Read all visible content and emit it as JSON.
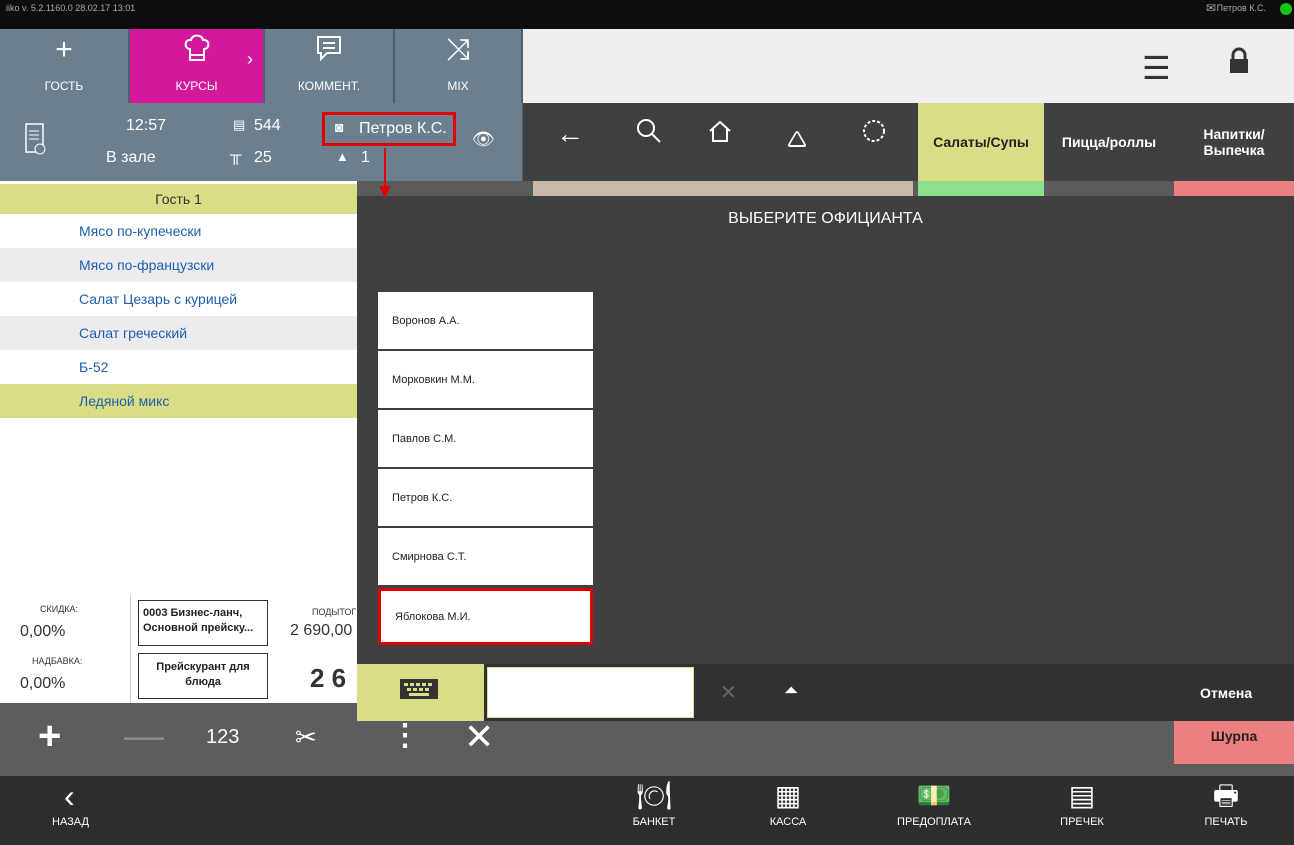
{
  "sysbar": {
    "version": "iiko v. 5.2.1160.0   28.02.17  13:01",
    "user": "Петров К.С."
  },
  "toolbar": {
    "guest_label": "ГОСТЬ",
    "courses_label": "КУРСЫ",
    "comment_label": "КОММЕНТ.",
    "mix_label": "MIX"
  },
  "info": {
    "time": "12:57",
    "location": "В зале",
    "order_number": "544",
    "table_number": "25",
    "waiter": "Петров К.С.",
    "guests_count": "1"
  },
  "categories": [
    "Салаты/Супы",
    "Пицца/роллы",
    "Напитки/ Выпечка"
  ],
  "order": {
    "guest_label": "Гость 1",
    "items": [
      "Мясо по-купечески",
      "Мясо по-французски",
      "Салат Цезарь с курицей",
      "Салат греческий",
      "Б-52",
      "Ледяной микс"
    ]
  },
  "totals": {
    "discount_label": "СКИДКА:",
    "discount_value": "0,00%",
    "markup_label": "НАДБАВКА:",
    "markup_value": "0,00%",
    "pricelist": "0003 Бизнес-ланч, Основной прейску...",
    "pricelist_for_dish": "Прейскурант для блюда",
    "subtotal_label": "ПОДЫТОГ",
    "subtotal_value": "2 690,00",
    "total_partial": "2 6"
  },
  "editbar": {
    "number_label": "123"
  },
  "footer": {
    "back_label": "НАЗАД",
    "banquet_label": "БАНКЕТ",
    "cashier_label": "КАССА",
    "prepay_label": "ПРЕДОПЛАТА",
    "precheck_label": "ПРЕЧЕК",
    "print_label": "ПЕЧАТЬ"
  },
  "modal": {
    "title": "ВЫБЕРИТЕ ОФИЦИАНТА",
    "waiters": [
      "Воронов А.А.",
      "Морковкин М.М.",
      "Павлов С.М.",
      "Петров К.С.",
      "Смирнова С.Т.",
      "Яблокова М.И."
    ],
    "cancel_label": "Отмена",
    "search_value": ""
  },
  "right_tile_label": "Шурпа",
  "colors": {
    "accent": "#d4189c",
    "highlight": "#d9dd85",
    "tile_red": "#ee7f7f",
    "annotation_red": "#e00000"
  }
}
